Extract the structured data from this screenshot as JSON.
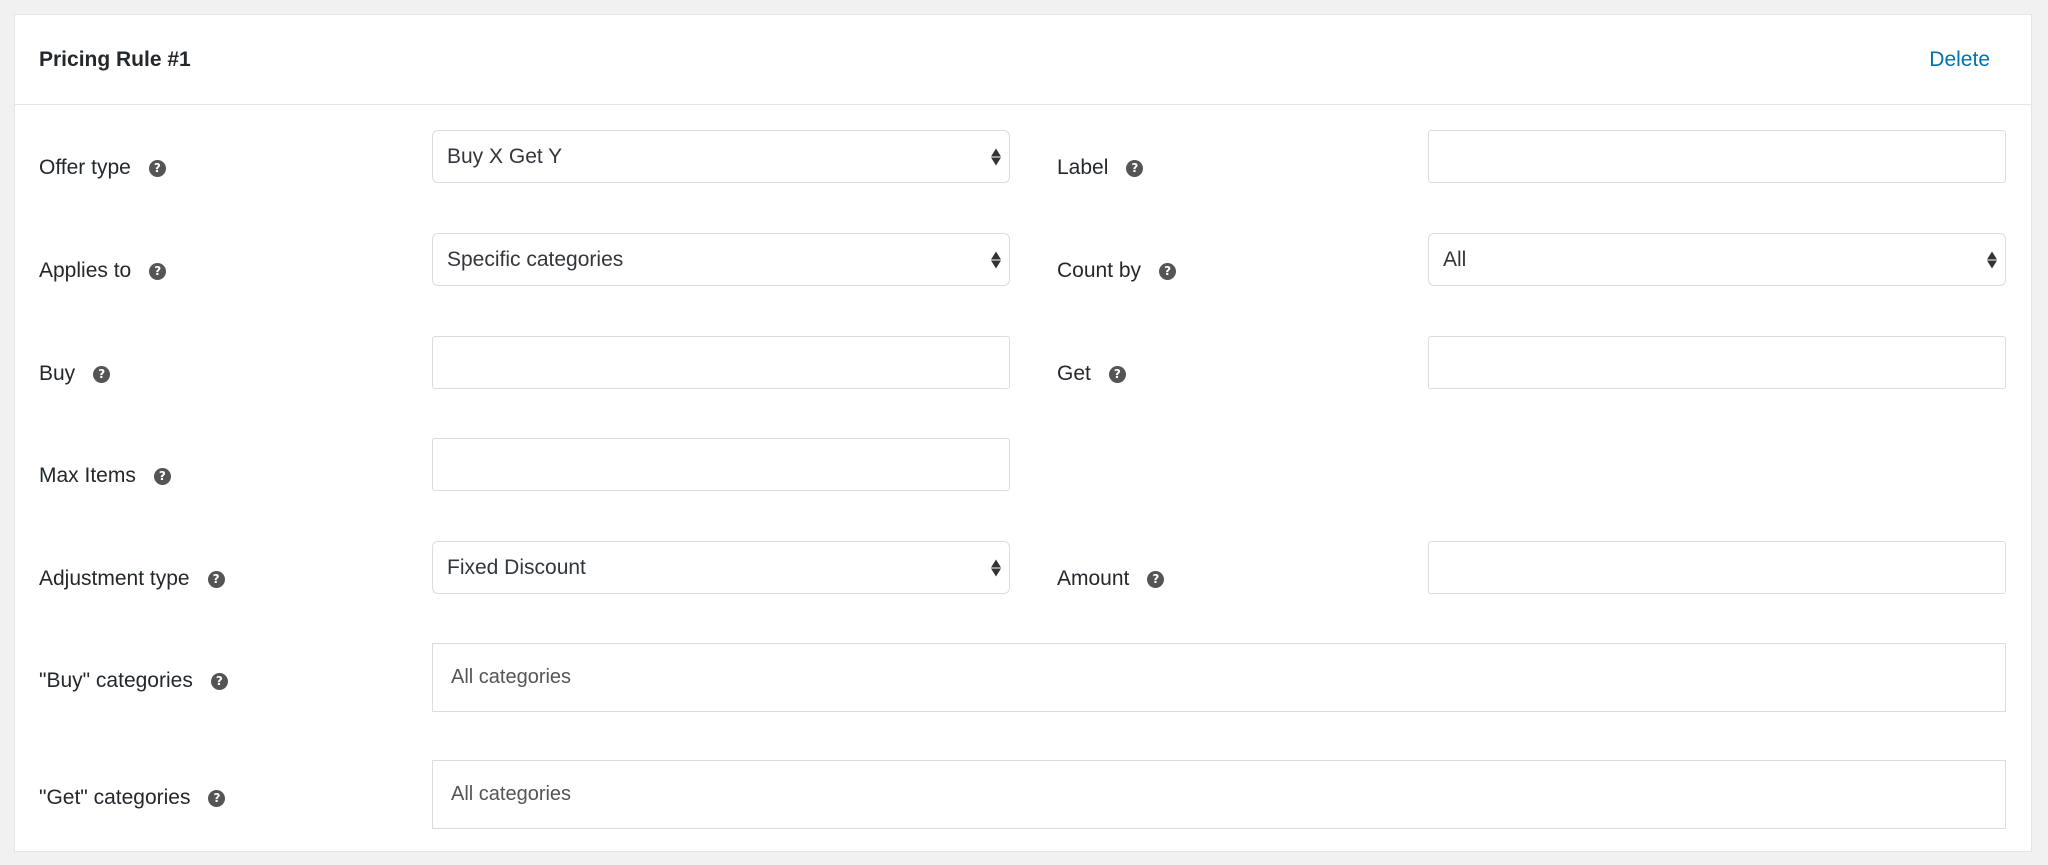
{
  "panel": {
    "title": "Pricing Rule #1",
    "delete_label": "Delete"
  },
  "fields": {
    "offer_type": {
      "label": "Offer type",
      "value": "Buy X Get Y"
    },
    "label": {
      "label": "Label",
      "value": ""
    },
    "applies_to": {
      "label": "Applies to",
      "value": "Specific categories"
    },
    "count_by": {
      "label": "Count by",
      "value": "All"
    },
    "buy": {
      "label": "Buy",
      "value": ""
    },
    "get": {
      "label": "Get",
      "value": ""
    },
    "max_items": {
      "label": "Max Items",
      "value": ""
    },
    "adjustment_type": {
      "label": "Adjustment type",
      "value": "Fixed Discount"
    },
    "amount": {
      "label": "Amount",
      "value": ""
    },
    "buy_categories": {
      "label": "\"Buy\" categories",
      "placeholder": "All categories"
    },
    "get_categories": {
      "label": "\"Get\" categories",
      "placeholder": "All categories"
    }
  },
  "help_icon_glyph": "?",
  "colors": {
    "link": "#0073aa",
    "text": "#23282d",
    "border": "#dcdcdc",
    "background": "#f1f1f1"
  }
}
